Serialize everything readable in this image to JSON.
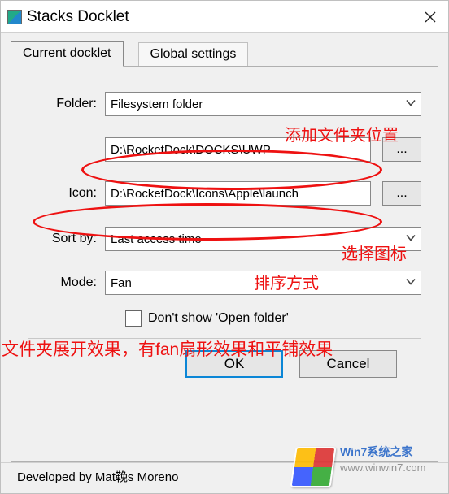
{
  "window": {
    "title": "Stacks Docklet"
  },
  "tabs": {
    "active": "Current docklet",
    "inactive": "Global settings"
  },
  "form": {
    "folder_label": "Folder:",
    "folder_combo": "Filesystem folder",
    "folder_path": "D:\\RocketDock\\DOCKS\\UWP",
    "icon_label": "Icon:",
    "icon_path": "D:\\RocketDock\\Icons\\Apple\\launch",
    "browse_label": "...",
    "sortby_label": "Sort by:",
    "sortby_value": "Last access time",
    "mode_label": "Mode:",
    "mode_value": "Fan",
    "checkbox_label": "Don't show 'Open folder'"
  },
  "buttons": {
    "ok": "OK",
    "cancel": "Cancel"
  },
  "footer": {
    "developed_by": "Developed by Mat鞔s Moreno"
  },
  "annotations": {
    "a1": "添加文件夹位置",
    "a2": "选择图标",
    "a3": "排序方式",
    "a4": "文件夹展开效果，有fan扇形效果和平铺效果"
  },
  "watermark": {
    "line1": "Win7系统之家",
    "line2": "www.winwin7.com"
  }
}
